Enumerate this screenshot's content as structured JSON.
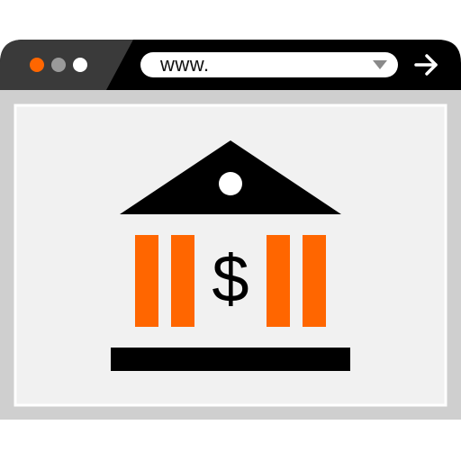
{
  "browser": {
    "address_bar": {
      "value": "www."
    },
    "window_controls": [
      "close-dot",
      "minimize-dot",
      "maximize-dot"
    ],
    "dropdown_icon": "triangle-down-icon",
    "go_icon": "arrow-right-icon"
  },
  "content": {
    "bank_icon": "bank-icon",
    "currency_symbol": "$"
  },
  "colors": {
    "titlebar_dark": "#000000",
    "titlebar_mid": "#3a3a3a",
    "frame": "#cfcfcf",
    "content_bg": "#f1f1f1",
    "accent": "#ff6600",
    "dot_gray": "#9a9a9a",
    "dot_white": "#ffffff"
  }
}
